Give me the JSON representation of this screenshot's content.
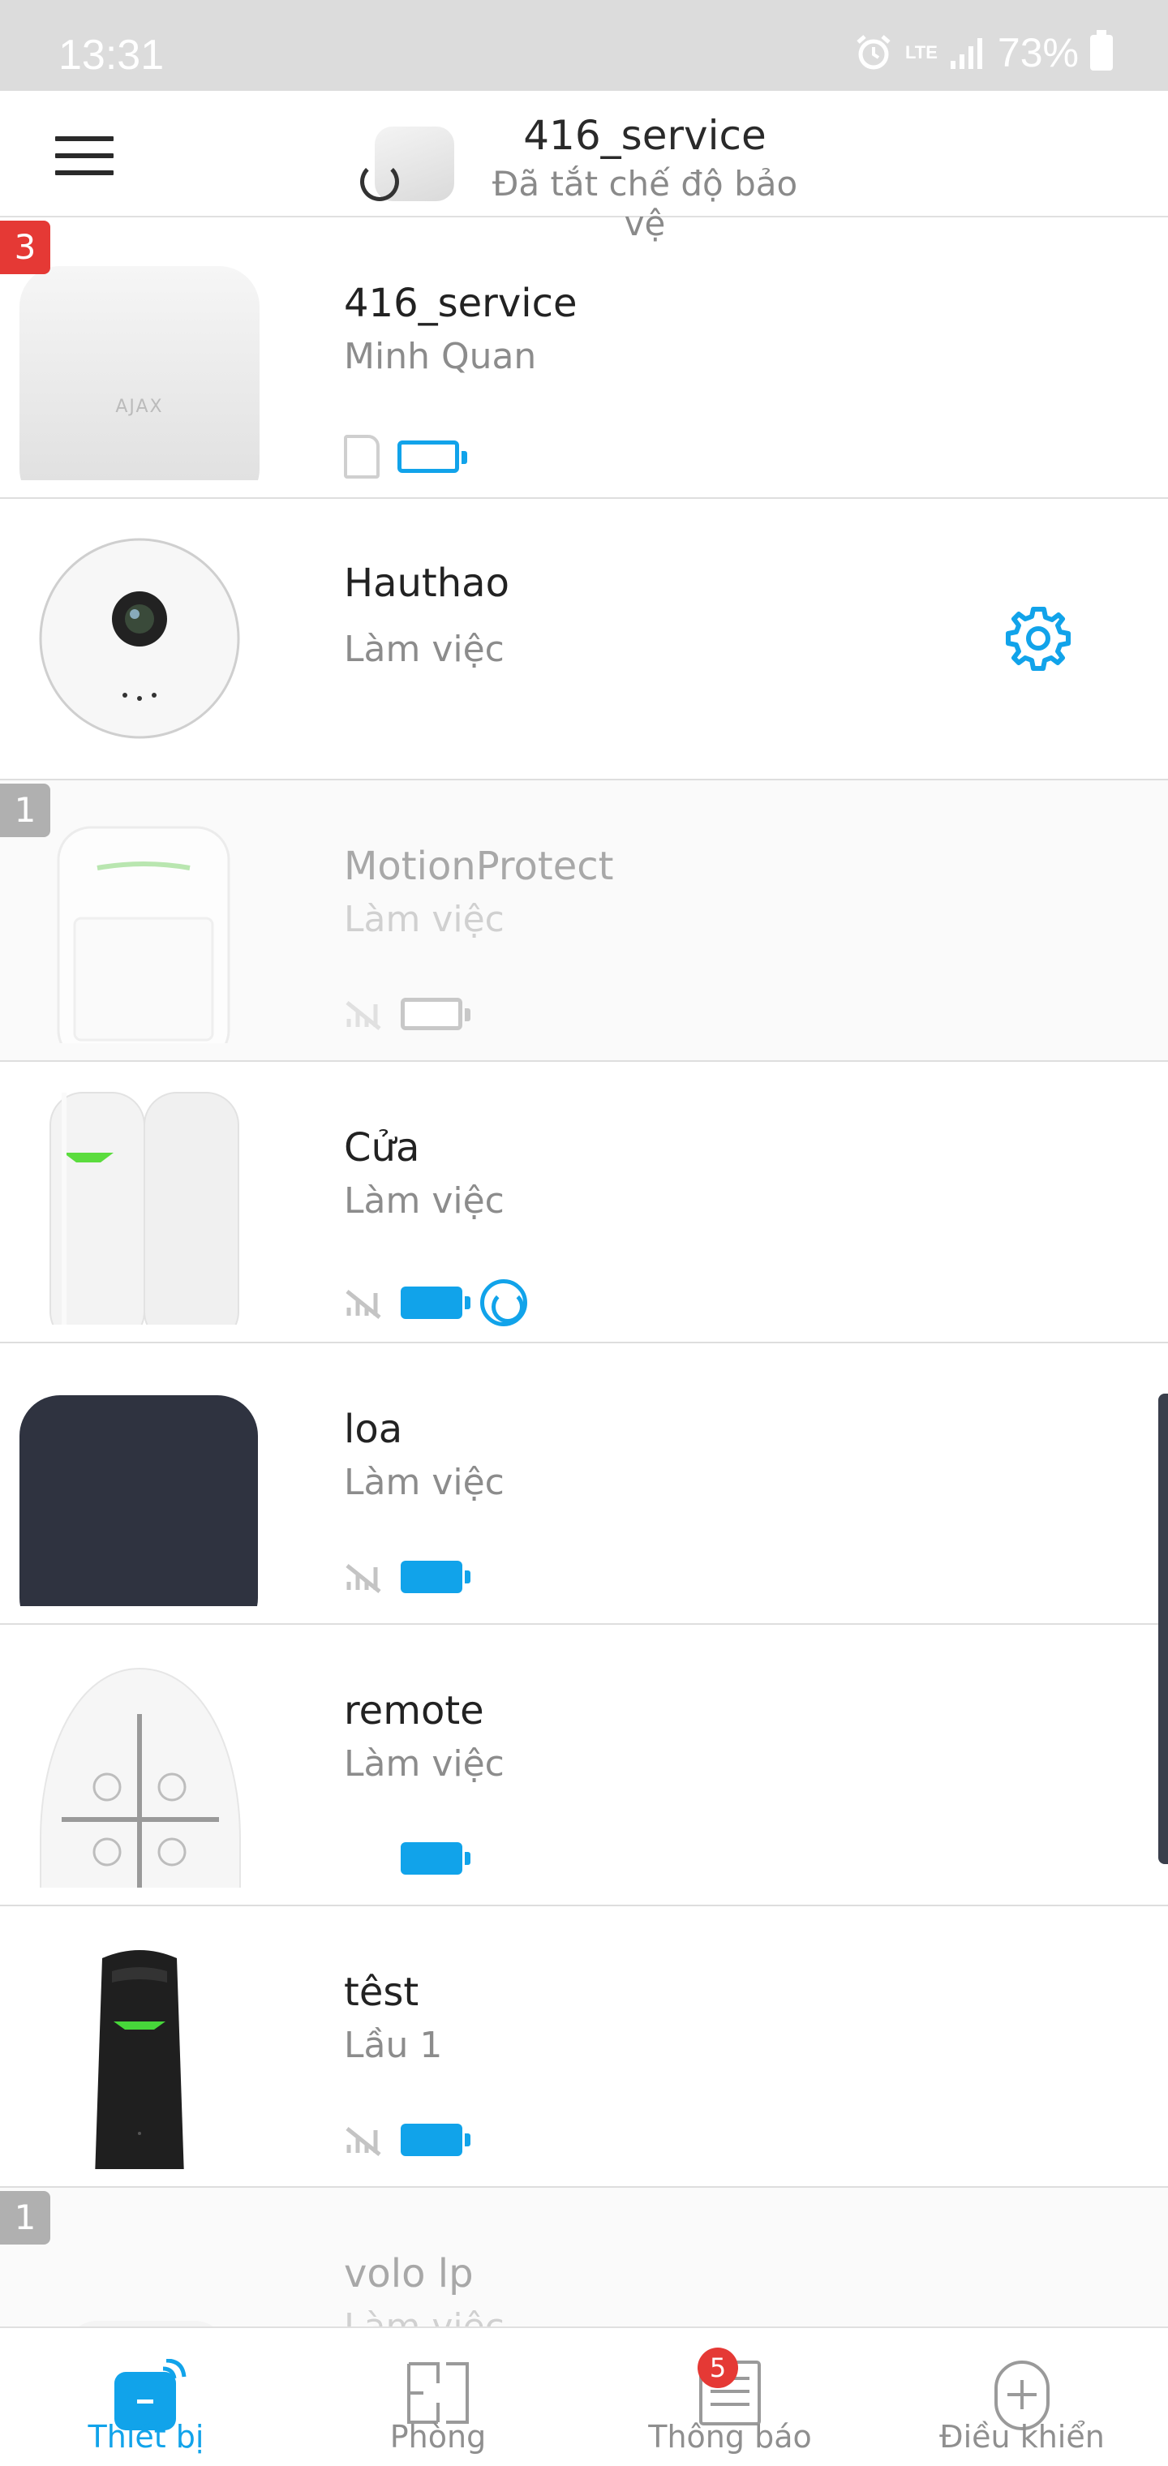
{
  "status_bar": {
    "time": "13:31",
    "network": "LTE",
    "battery": "73%"
  },
  "header": {
    "title": "416_service",
    "subtitle": "Đã tắt chế độ bảo vệ"
  },
  "devices": [
    {
      "name": "416_service",
      "status": "Minh Quan",
      "badge": "3"
    },
    {
      "name": "Hauthao",
      "status": "Làm việc"
    },
    {
      "name": "MotionProtect",
      "status": "Làm việc",
      "badge": "1"
    },
    {
      "name": "Cửa",
      "status": "Làm việc"
    },
    {
      "name": "loa",
      "status": "Làm việc"
    },
    {
      "name": "remote",
      "status": "Làm việc"
    },
    {
      "name": "têst",
      "status": "Lầu 1"
    },
    {
      "name": "volo lp",
      "status": "Làm việc",
      "badge": "1"
    }
  ],
  "bottom_nav": {
    "tabs": [
      {
        "label": "Thiết bị",
        "icon": "devices-icon"
      },
      {
        "label": "Phòng",
        "icon": "rooms-icon"
      },
      {
        "label": "Thông báo",
        "icon": "notifications-icon",
        "badge": "5"
      },
      {
        "label": "Điều khiển",
        "icon": "control-icon"
      }
    ]
  },
  "colors": {
    "accent": "#11a3ea",
    "badge_red": "#e53935",
    "badge_gray": "#b0b0b0"
  }
}
